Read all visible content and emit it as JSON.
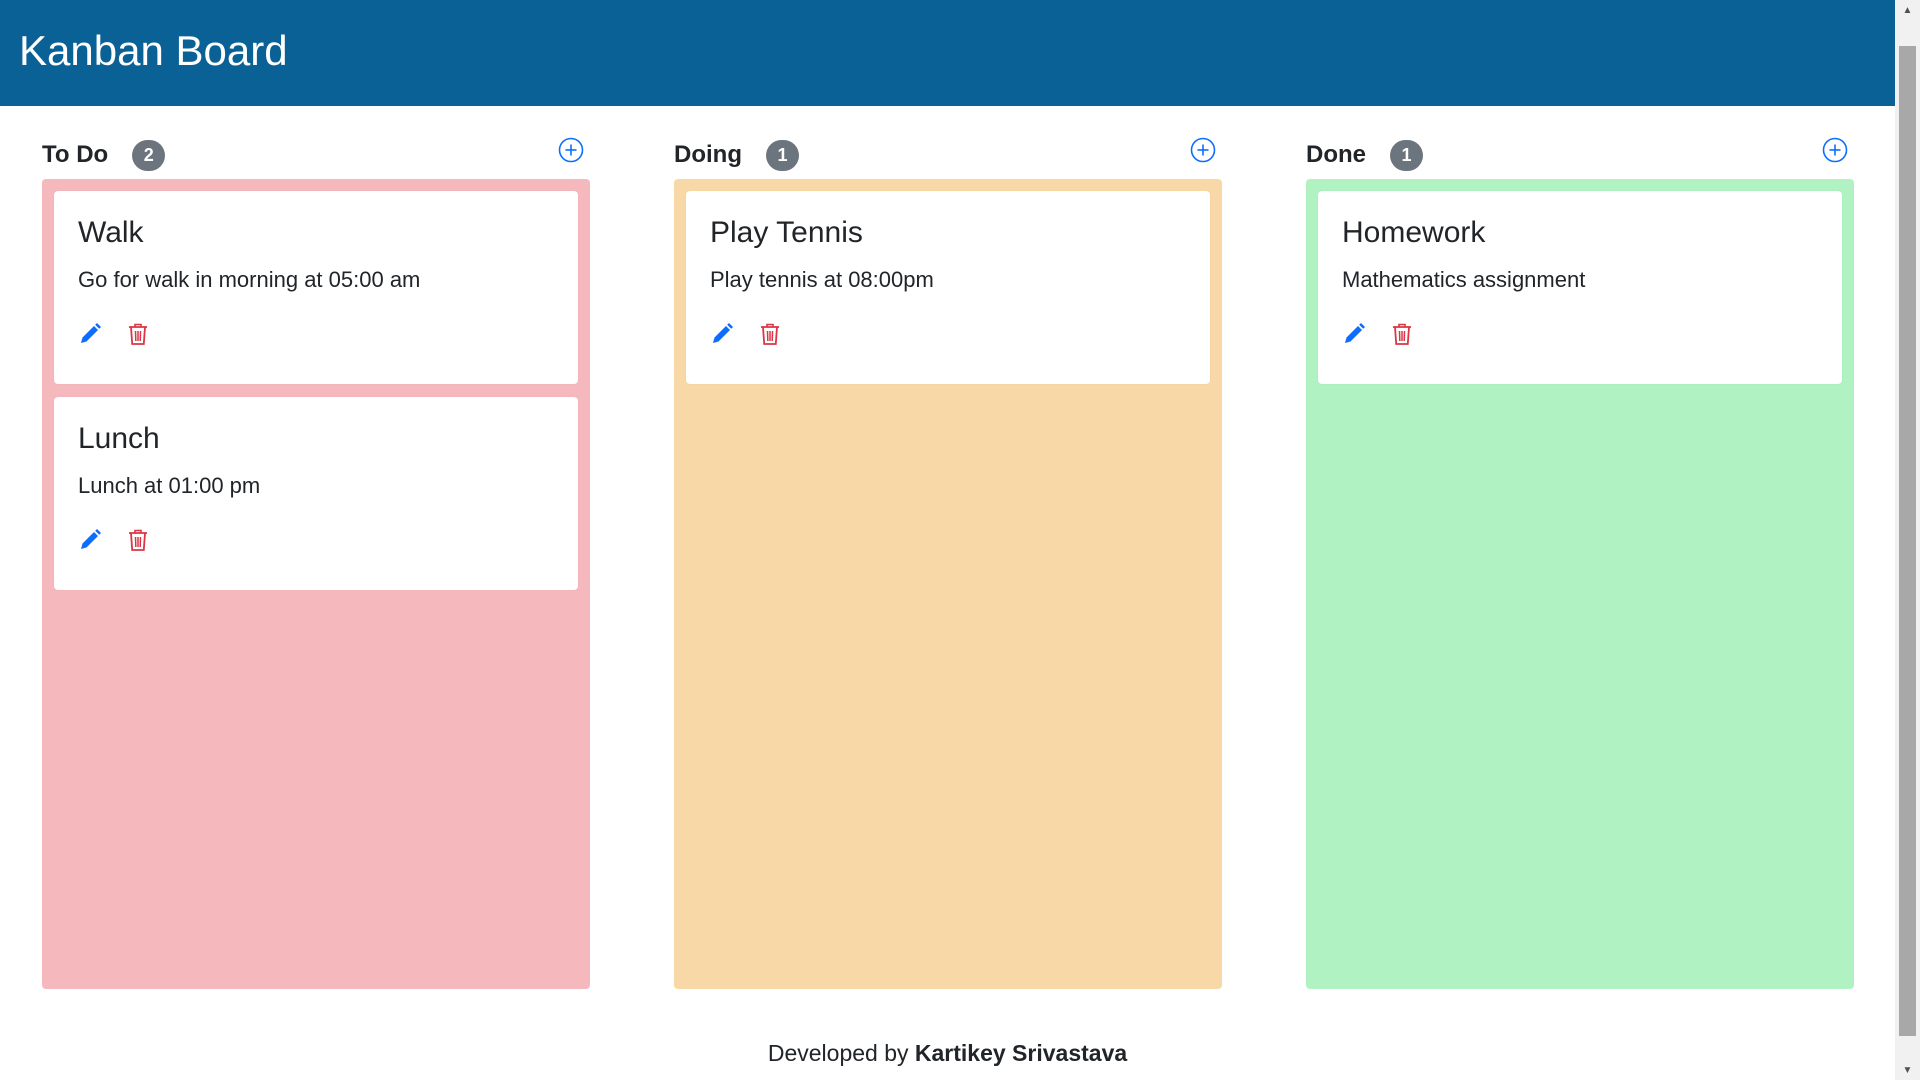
{
  "app": {
    "title": "Kanban Board",
    "brand_color": "#0a6196"
  },
  "columns": [
    {
      "title": "To Do",
      "count": "2",
      "color": "#f4b8bd",
      "add_icon": "plus-circle-icon",
      "cards": [
        {
          "title": "Walk",
          "description": "Go for walk in morning at 05:00 am"
        },
        {
          "title": "Lunch",
          "description": "Lunch at 01:00 pm"
        }
      ]
    },
    {
      "title": "Doing",
      "count": "1",
      "color": "#f8d8a6",
      "add_icon": "plus-circle-icon",
      "cards": [
        {
          "title": "Play Tennis",
          "description": "Play tennis at 08:00pm"
        }
      ]
    },
    {
      "title": "Done",
      "count": "1",
      "color": "#b1f2c3",
      "add_icon": "plus-circle-icon",
      "cards": [
        {
          "title": "Homework",
          "description": "Mathematics assignment"
        }
      ]
    }
  ],
  "card_actions": {
    "edit_icon": "pencil-icon",
    "edit_color": "#0d6efd",
    "delete_icon": "trash-icon",
    "delete_color": "#dc3545"
  },
  "footer": {
    "prefix": "Developed by ",
    "author": "Kartikey Srivastava"
  }
}
